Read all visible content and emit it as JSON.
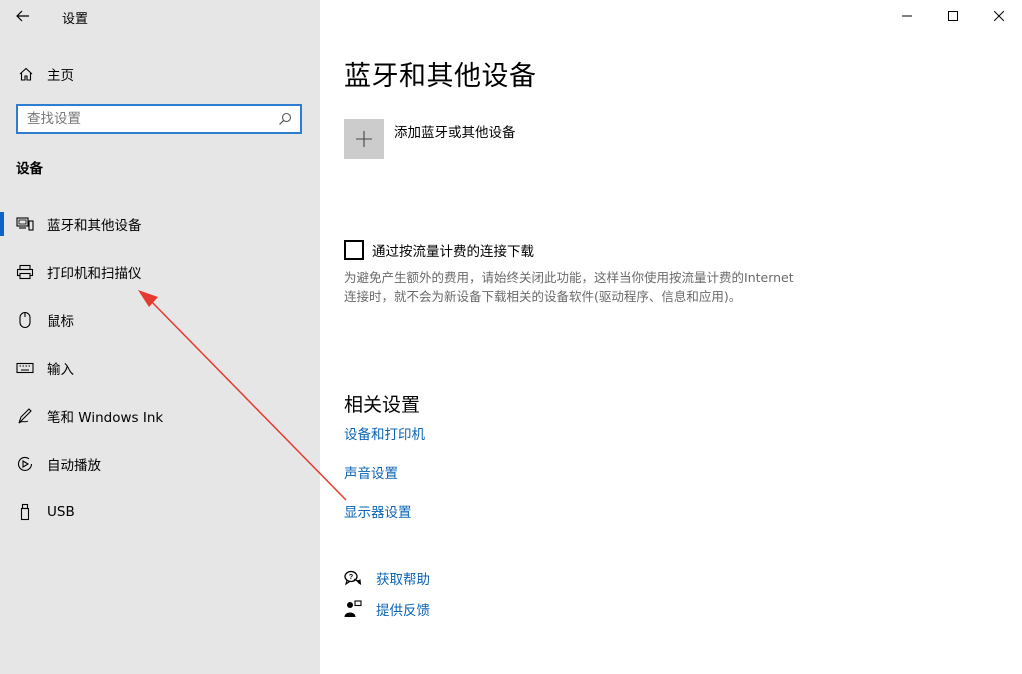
{
  "window": {
    "title": "设置"
  },
  "sidebar": {
    "home_label": "主页",
    "search": {
      "placeholder": "查找设置",
      "value": ""
    },
    "section_title": "设备",
    "items": [
      {
        "label": "蓝牙和其他设备",
        "icon": "bluetooth-devices-icon",
        "active": true
      },
      {
        "label": "打印机和扫描仪",
        "icon": "printer-icon",
        "active": false
      },
      {
        "label": "鼠标",
        "icon": "mouse-icon",
        "active": false
      },
      {
        "label": "输入",
        "icon": "keyboard-icon",
        "active": false
      },
      {
        "label": "笔和 Windows Ink",
        "icon": "pen-icon",
        "active": false
      },
      {
        "label": "自动播放",
        "icon": "autoplay-icon",
        "active": false
      },
      {
        "label": "USB",
        "icon": "usb-icon",
        "active": false
      }
    ]
  },
  "main": {
    "title": "蓝牙和其他设备",
    "add_device_label": "添加蓝牙或其他设备",
    "metered": {
      "label": "通过按流量计费的连接下载",
      "checked": false,
      "description": "为避免产生额外的费用，请始终关闭此功能，这样当你使用按流量计费的Internet 连接时，就不会为新设备下载相关的设备软件(驱动程序、信息和应用)。"
    },
    "related": {
      "title": "相关设置",
      "links": [
        "设备和打印机",
        "声音设置",
        "显示器设置"
      ]
    },
    "help": {
      "get_help": "获取帮助",
      "feedback": "提供反馈"
    }
  },
  "colors": {
    "accent": "#0a64c8",
    "link": "#0a64b4",
    "sidebar_bg": "#e6e6e6",
    "annotation_arrow": "#e53a2f"
  }
}
